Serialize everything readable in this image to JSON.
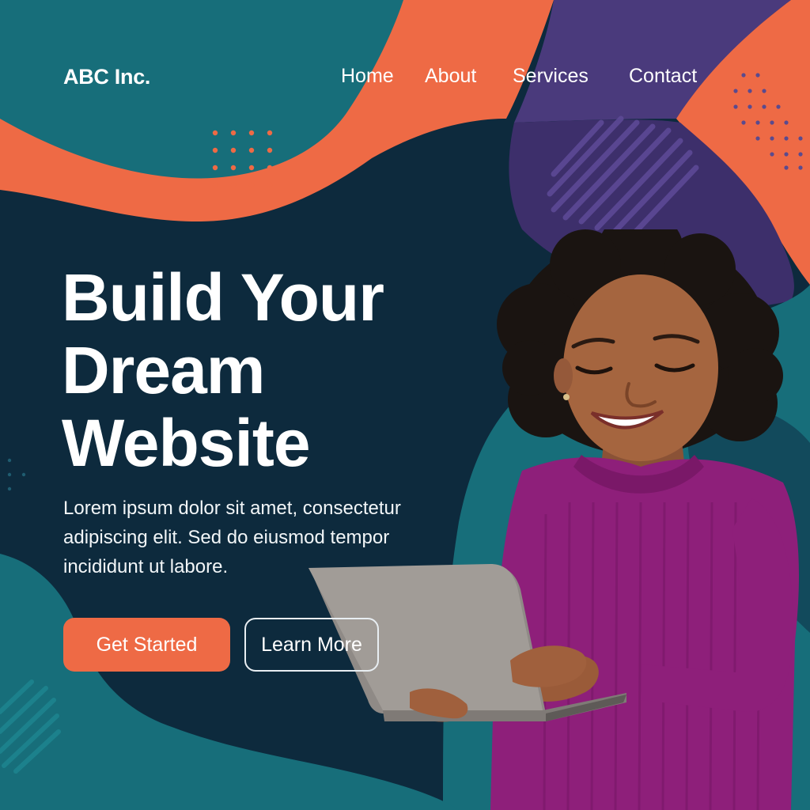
{
  "header": {
    "brand": "ABC Inc.",
    "nav": [
      {
        "label": "Home"
      },
      {
        "label": "About"
      },
      {
        "label": "Services"
      },
      {
        "label": "Contact"
      }
    ]
  },
  "hero": {
    "title_lines": [
      "Build Your",
      "Dream",
      "Website"
    ],
    "description": "Lorem ipsum dolor sit amet, consectetur adipiscing elit. Sed do eiusmod tempor incididunt ut labore.",
    "primary_button": "Get Started",
    "secondary_button": "Learn More"
  },
  "colors": {
    "background": "#0d2a3d",
    "teal": "#176e7a",
    "orange": "#ee6a45",
    "purple": "#4a3a7c",
    "sweater": "#8e1f7a"
  },
  "illustration": {
    "subject": "woman-with-laptop"
  }
}
